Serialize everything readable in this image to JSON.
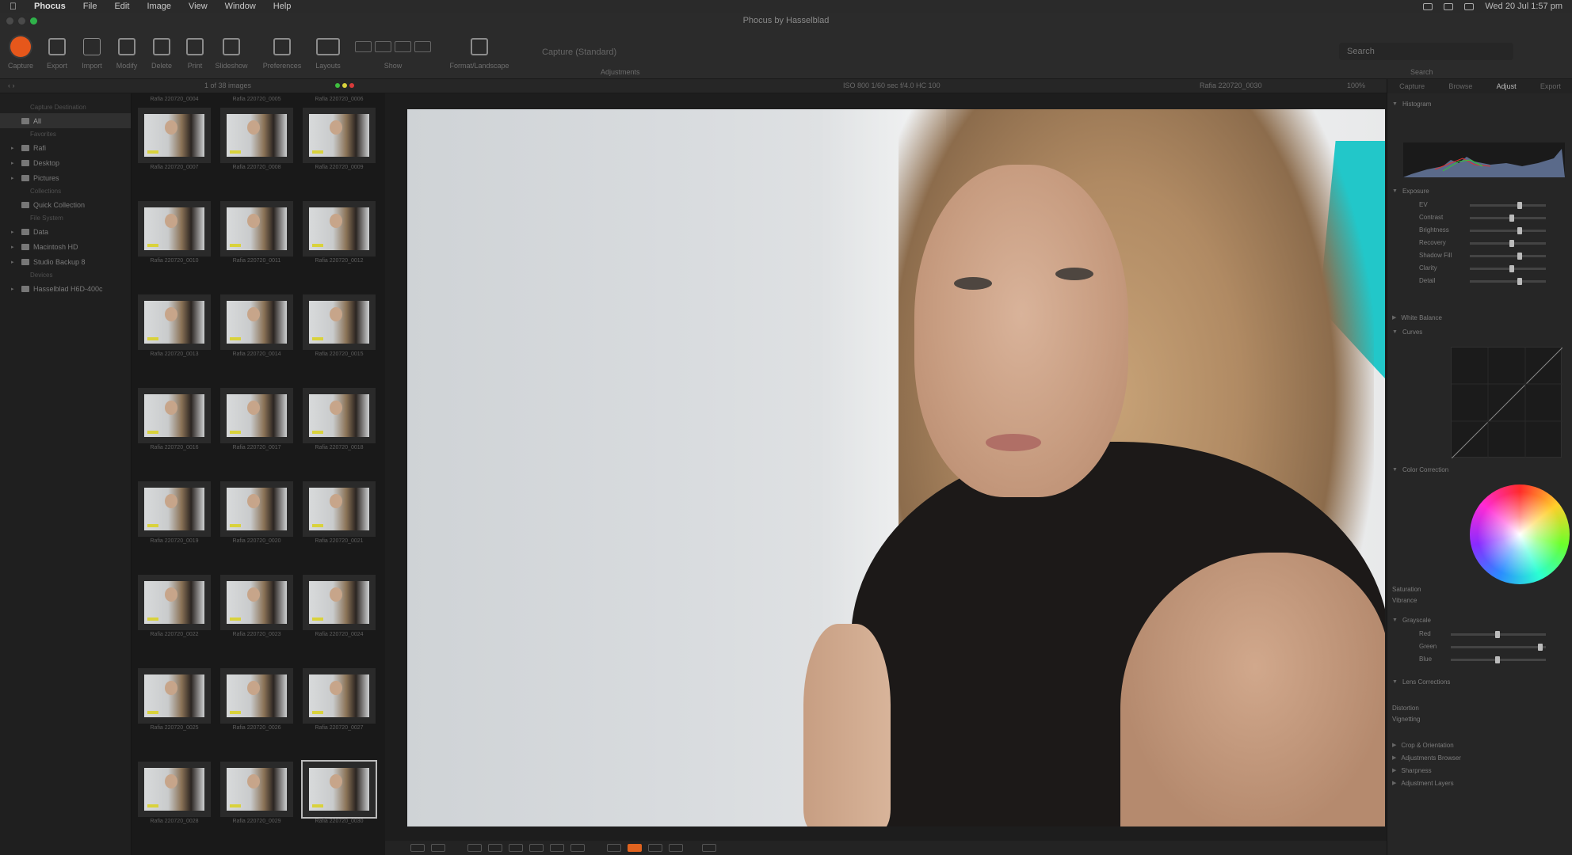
{
  "menubar": {
    "apple": "",
    "app": "Phocus",
    "items": [
      "File",
      "Edit",
      "Image",
      "View",
      "Window",
      "Help"
    ],
    "clock": "Wed 20 Jul 1:57 pm"
  },
  "window": {
    "title": "Phocus by Hasselblad"
  },
  "toolbar": {
    "buttons": [
      "Capture",
      "Export",
      "Import",
      "Modify",
      "Delete",
      "Print",
      "Slideshow",
      "Preferences",
      "Layouts"
    ],
    "show_label": "Show",
    "format_label": "Format/Landscape",
    "adjustments_label": "Adjustments",
    "style_select": "Capture (Standard)",
    "search_placeholder": "Search",
    "search_label": "Search"
  },
  "substrip": {
    "count": "1 of 38 images",
    "info": "ISO 800  1/60 sec  f/4.0  HC 100",
    "filename": "Rafia 220720_0030",
    "zoom": "100%"
  },
  "sidebar": {
    "sections": [
      {
        "header": "Capture Destination",
        "items": [
          {
            "label": "All",
            "sel": true
          }
        ]
      },
      {
        "header": "Favorites",
        "items": [
          {
            "label": "Rafi"
          },
          {
            "label": "Desktop"
          },
          {
            "label": "Pictures"
          }
        ]
      },
      {
        "header": "Collections",
        "items": [
          {
            "label": "Quick Collection"
          }
        ]
      },
      {
        "header": "File System",
        "items": [
          {
            "label": "Data"
          },
          {
            "label": "Macintosh HD"
          },
          {
            "label": "Studio Backup 8"
          }
        ]
      },
      {
        "header": "Devices",
        "items": [
          {
            "label": "Hasselblad H6D-400c"
          }
        ]
      }
    ]
  },
  "thumbnails": {
    "top_captions": [
      "Rafia 220720_0004",
      "Rafia 220720_0005",
      "Rafia 220720_0006"
    ],
    "rows": [
      [
        "Rafia 220720_0007",
        "Rafia 220720_0008",
        "Rafia 220720_0009"
      ],
      [
        "Rafia 220720_0010",
        "Rafia 220720_0011",
        "Rafia 220720_0012"
      ],
      [
        "Rafia 220720_0013",
        "Rafia 220720_0014",
        "Rafia 220720_0015"
      ],
      [
        "Rafia 220720_0016",
        "Rafia 220720_0017",
        "Rafia 220720_0018"
      ],
      [
        "Rafia 220720_0019",
        "Rafia 220720_0020",
        "Rafia 220720_0021"
      ],
      [
        "Rafia 220720_0022",
        "Rafia 220720_0023",
        "Rafia 220720_0024"
      ],
      [
        "Rafia 220720_0025",
        "Rafia 220720_0026",
        "Rafia 220720_0027"
      ],
      [
        "Rafia 220720_0028",
        "Rafia 220720_0029",
        "Rafia 220720_0030"
      ]
    ],
    "selected_index": 23
  },
  "panel": {
    "tabs": [
      "Capture",
      "Browse",
      "Adjust",
      "Export"
    ],
    "active_tab": "Adjust",
    "sections": {
      "histogram": "Histogram",
      "exposure": "Exposure",
      "exposure_sliders": [
        "EV",
        "Contrast",
        "Brightness",
        "Recovery",
        "Shadow Fill",
        "Clarity",
        "Detail"
      ],
      "white_balance": "White Balance",
      "curves": "Curves",
      "color_correction": "Color Correction",
      "saturation": "Saturation",
      "vibrance": "Vibrance",
      "grayscale": "Grayscale",
      "grayscale_sliders": [
        "Red",
        "Green",
        "Blue"
      ],
      "lens_corrections": "Lens Corrections",
      "lens_items": [
        "Distortion",
        "Vignetting"
      ],
      "crop": "Crop & Orientation",
      "adjustments_browser": "Adjustments Browser",
      "sharpness": "Sharpness",
      "adjustment_layers": "Adjustment Layers"
    },
    "colors": {
      "accent": "#e6571b",
      "tag": "#d9d23c",
      "cyan": "#22c7c9"
    }
  }
}
